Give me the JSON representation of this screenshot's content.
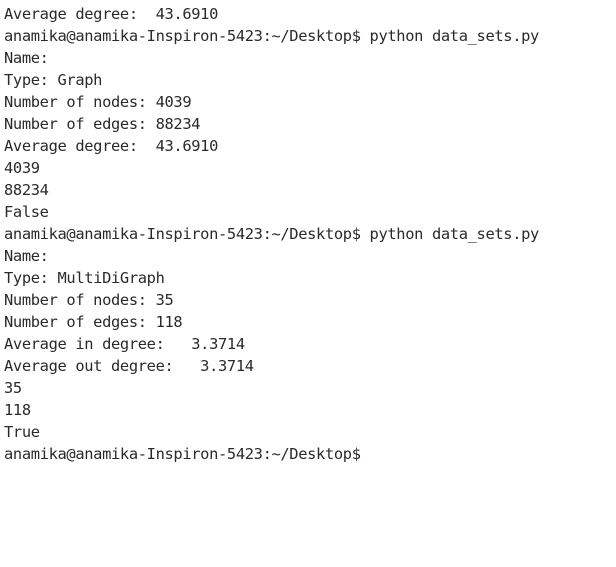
{
  "terminal": {
    "lines": [
      "Average degree:  43.6910",
      "anamika@anamika-Inspiron-5423:~/Desktop$ python data_sets.py",
      "Name:",
      "Type: Graph",
      "Number of nodes: 4039",
      "Number of edges: 88234",
      "Average degree:  43.6910",
      "4039",
      "88234",
      "False",
      "anamika@anamika-Inspiron-5423:~/Desktop$ python data_sets.py",
      "Name:",
      "Type: MultiDiGraph",
      "Number of nodes: 35",
      "Number of edges: 118",
      "Average in degree:   3.3714",
      "Average out degree:   3.3714",
      "35",
      "118",
      "True",
      "anamika@anamika-Inspiron-5423:~/Desktop$"
    ]
  }
}
